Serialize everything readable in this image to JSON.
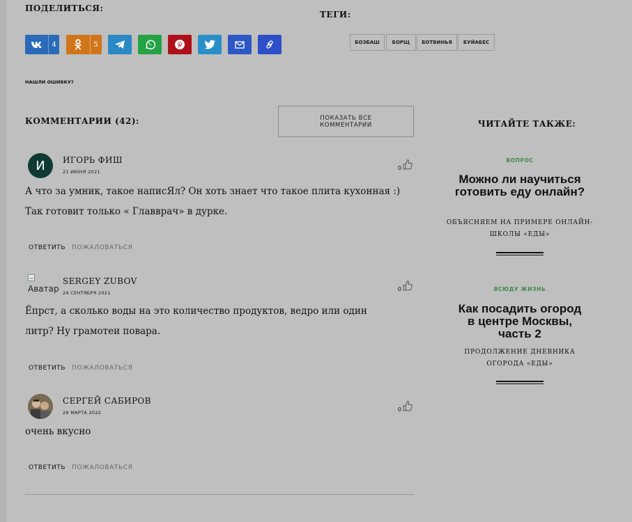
{
  "share": {
    "title": "ПОДЕЛИТЬСЯ:",
    "buttons": [
      {
        "name": "vk",
        "icon": "vk-icon",
        "count": "4",
        "color": "#2b6ab8"
      },
      {
        "name": "ok",
        "icon": "odnoklassniki-icon",
        "count": "5",
        "color": "#d1751b"
      },
      {
        "name": "telegram",
        "icon": "telegram-icon",
        "count": "",
        "color": "#2a88c4"
      },
      {
        "name": "whatsapp",
        "icon": "whatsapp-icon",
        "count": "",
        "color": "#22a344"
      },
      {
        "name": "pinterest",
        "icon": "pinterest-icon",
        "count": "",
        "color": "#b0101a"
      },
      {
        "name": "twitter",
        "icon": "twitter-icon",
        "count": "",
        "color": "#2a8fc9"
      },
      {
        "name": "email",
        "icon": "mail-icon",
        "count": "",
        "color": "#2e57c6"
      },
      {
        "name": "copy-link",
        "icon": "link-icon",
        "count": "",
        "color": "#2f4fc8"
      }
    ]
  },
  "tags": {
    "title": "ТЕГИ:",
    "items": [
      "БОЗБАШ",
      "БОРЩ",
      "БОТВИНЬЯ",
      "БУЙАБЕС"
    ]
  },
  "error_link": "НАШЛИ ОШИБКУ?",
  "comments_section": {
    "title": "КОММЕНТАРИИ (42):",
    "show_all": "ПОКАЗАТЬ ВСЕ КОММЕНТАРИИ"
  },
  "comments": [
    {
      "author": "ИГОРЬ ФИШ",
      "date": "21 ИЮНЯ 2021",
      "avatar_letter": "И",
      "avatar_color": "#0e3a33",
      "likes": "0",
      "text": "А что за умник, такое написЯл? Он хоть знает что такое плита кухонная :) Так готовит только « Главврач» в дурке.",
      "reply": "ОТВЕТИТЬ",
      "report": "ПОЖАЛОВАТЬСЯ"
    },
    {
      "author": "SERGEY ZUBOV",
      "date": "24 СЕНТЯБРЯ 2021",
      "avatar_alt": "Аватар",
      "likes": "0",
      "text": "Ёпрст, а сколько воды на это количество продуктов, ведро или один литр? Ну грамотеи повара.",
      "reply": "ОТВЕТИТЬ",
      "report": "ПОЖАЛОВАТЬСЯ"
    },
    {
      "author": "СЕРГЕЙ САБИРОВ",
      "date": "29 МАРТА 2022",
      "likes": "0",
      "text": "очень вкусно",
      "reply": "ОТВЕТИТЬ",
      "report": "ПОЖАЛОВАТЬСЯ"
    }
  ],
  "sidebar": {
    "title": "ЧИТАЙТЕ ТАКЖЕ:",
    "articles": [
      {
        "category": "ВОПРОС",
        "headline": "Можно ли научиться готовить еду онлайн?",
        "subtitle": "ОБЪЯСНЯЕМ НА ПРИМЕРЕ ОНЛАЙН-ШКОЛЫ «ЕДЫ»"
      },
      {
        "category": "ВСЮДУ ЖИЗНЬ",
        "headline": "Как посадить огород в центре Москвы, часть 2",
        "subtitle": "ПРОДОЛЖЕНИЕ ДНЕВНИКА ОГОРОДА «ЕДЫ»"
      }
    ]
  },
  "colors": {
    "background": "#bfbfbf",
    "accent_green": "#3e8a4c"
  }
}
